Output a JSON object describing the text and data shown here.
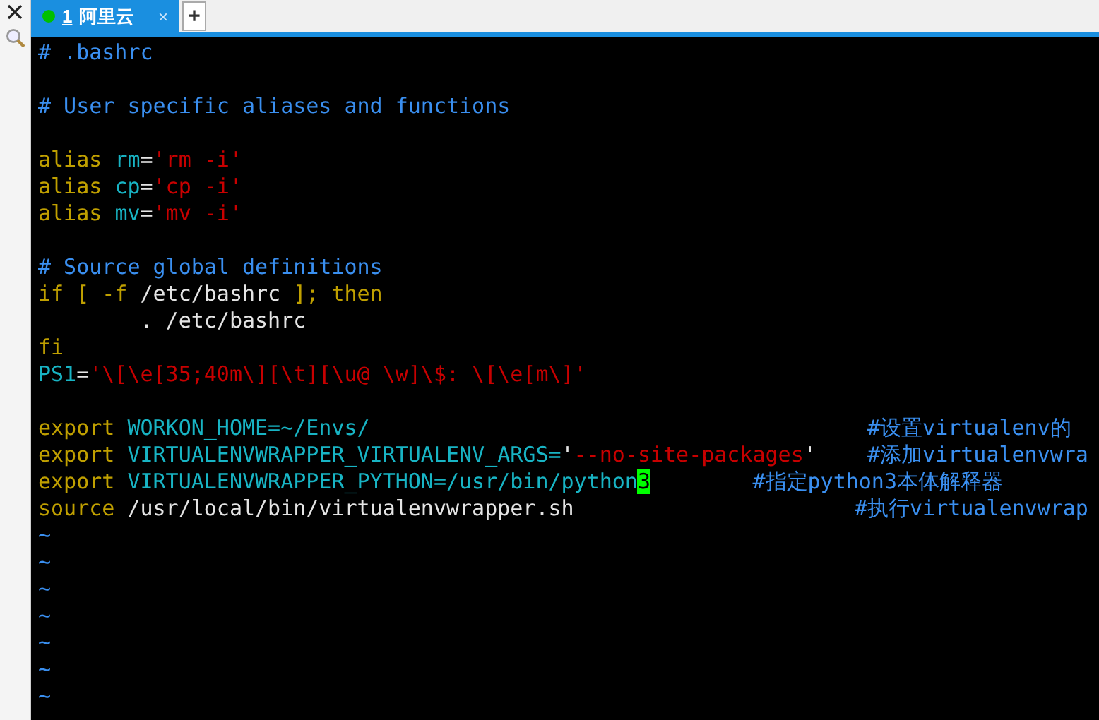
{
  "sidebar": {
    "items": [
      {
        "kind": "close"
      },
      {
        "kind": "search"
      }
    ]
  },
  "tabs": [
    {
      "number": "1",
      "label": "阿里云",
      "close": "×",
      "selected": true,
      "color": "#00c000"
    }
  ],
  "new_tab": "+",
  "editor": {
    "lines": [
      {
        "kind": "code",
        "segments": [
          {
            "kind": "comment",
            "text": "# .bashrc"
          }
        ]
      },
      {
        "kind": "blank"
      },
      {
        "kind": "code",
        "segments": [
          {
            "kind": "comment",
            "text": "# User specific aliases and functions"
          }
        ]
      },
      {
        "kind": "blank"
      },
      {
        "kind": "code",
        "segments": [
          {
            "kind": "keyword",
            "text": "alias"
          },
          {
            "kind": "variable",
            "text": " rm"
          },
          {
            "kind": "plain",
            "text": "="
          },
          {
            "kind": "string",
            "text": "'rm -i'"
          }
        ]
      },
      {
        "kind": "code",
        "segments": [
          {
            "kind": "keyword",
            "text": "alias"
          },
          {
            "kind": "variable",
            "text": " cp"
          },
          {
            "kind": "plain",
            "text": "="
          },
          {
            "kind": "string",
            "text": "'cp -i'"
          }
        ]
      },
      {
        "kind": "code",
        "segments": [
          {
            "kind": "keyword",
            "text": "alias"
          },
          {
            "kind": "variable",
            "text": " mv"
          },
          {
            "kind": "plain",
            "text": "="
          },
          {
            "kind": "string",
            "text": "'mv -i'"
          }
        ]
      },
      {
        "kind": "blank"
      },
      {
        "kind": "code",
        "segments": [
          {
            "kind": "comment",
            "text": "# Source global definitions"
          }
        ]
      },
      {
        "kind": "code",
        "segments": [
          {
            "kind": "keyword",
            "text": "if [ -f"
          },
          {
            "kind": "plain",
            "text": " /etc/bashrc"
          },
          {
            "kind": "keyword",
            "text": " ]; then"
          }
        ]
      },
      {
        "kind": "code",
        "segments": [
          {
            "kind": "plain",
            "text": "        . /etc/bashrc"
          }
        ]
      },
      {
        "kind": "code",
        "segments": [
          {
            "kind": "keyword",
            "text": "fi"
          }
        ]
      },
      {
        "kind": "code",
        "segments": [
          {
            "kind": "variable",
            "text": "PS1"
          },
          {
            "kind": "plain",
            "text": "="
          },
          {
            "kind": "string",
            "text": "'\\[\\e[35;40m\\][\\t][\\u@ \\w]\\$: \\[\\e[m\\]'"
          }
        ]
      },
      {
        "kind": "blank"
      },
      {
        "kind": "code",
        "segments": [
          {
            "kind": "keyword",
            "text": "export"
          },
          {
            "kind": "variable",
            "text": " WORKON_HOME=~/Envs/"
          },
          {
            "kind": "comment",
            "text": "                                       #设置virtualenv的"
          }
        ]
      },
      {
        "kind": "code",
        "segments": [
          {
            "kind": "keyword",
            "text": "export"
          },
          {
            "kind": "variable",
            "text": " VIRTUALENVWRAPPER_VIRTUALENV_ARGS="
          },
          {
            "kind": "plain",
            "text": "'"
          },
          {
            "kind": "string",
            "text": "--no-site-packages"
          },
          {
            "kind": "plain",
            "text": "'"
          },
          {
            "kind": "comment",
            "text": "    #添加virtualenvwra"
          }
        ]
      },
      {
        "kind": "code",
        "segments": [
          {
            "kind": "keyword",
            "text": "export"
          },
          {
            "kind": "variable",
            "text": " VIRTUALENVWRAPPER_PYTHON=/usr/bin/python"
          },
          {
            "kind": "cursor",
            "text": "3"
          },
          {
            "kind": "comment",
            "text": "        #指定python3本体解释器"
          }
        ]
      },
      {
        "kind": "code",
        "segments": [
          {
            "kind": "keyword",
            "text": "source"
          },
          {
            "kind": "plain",
            "text": " /usr/local/bin/virtualenvwrapper.sh"
          },
          {
            "kind": "comment",
            "text": "                      #执行virtualenvwrap"
          }
        ]
      },
      {
        "kind": "tilde",
        "text": "~"
      },
      {
        "kind": "tilde",
        "text": "~"
      },
      {
        "kind": "tilde",
        "text": "~"
      },
      {
        "kind": "tilde",
        "text": "~"
      },
      {
        "kind": "tilde",
        "text": "~"
      },
      {
        "kind": "tilde",
        "text": "~"
      },
      {
        "kind": "tilde",
        "text": "~"
      }
    ]
  }
}
